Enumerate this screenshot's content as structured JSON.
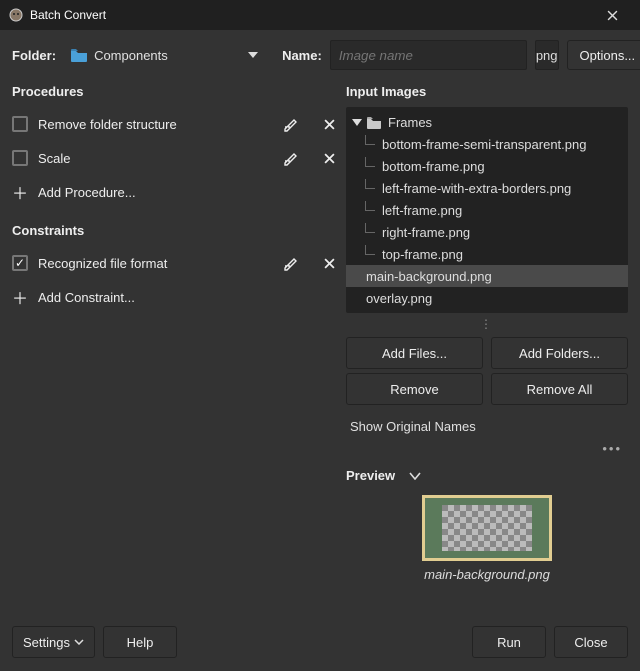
{
  "window": {
    "title": "Batch Convert"
  },
  "top": {
    "folder_label": "Folder:",
    "folder_value": "Components",
    "name_label": "Name:",
    "name_placeholder": "Image name",
    "ext": "png",
    "options_label": "Options..."
  },
  "procedures": {
    "title": "Procedures",
    "items": [
      {
        "label": "Remove folder structure",
        "checked": false
      },
      {
        "label": "Scale",
        "checked": false
      }
    ],
    "add_label": "Add Procedure..."
  },
  "constraints": {
    "title": "Constraints",
    "items": [
      {
        "label": "Recognized file format",
        "checked": true
      }
    ],
    "add_label": "Add Constraint..."
  },
  "input": {
    "title": "Input Images",
    "folder": "Frames",
    "children": [
      "bottom-frame-semi-transparent.png",
      "bottom-frame.png",
      "left-frame-with-extra-borders.png",
      "left-frame.png",
      "right-frame.png",
      "top-frame.png"
    ],
    "siblings": [
      "main-background.png",
      "overlay.png"
    ],
    "selected": "main-background.png",
    "add_files": "Add Files...",
    "add_folders": "Add Folders...",
    "remove": "Remove",
    "remove_all": "Remove All",
    "show_original": "Show Original Names"
  },
  "preview": {
    "title": "Preview",
    "caption": "main-background.png"
  },
  "footer": {
    "settings": "Settings",
    "help": "Help",
    "run": "Run",
    "close": "Close"
  }
}
